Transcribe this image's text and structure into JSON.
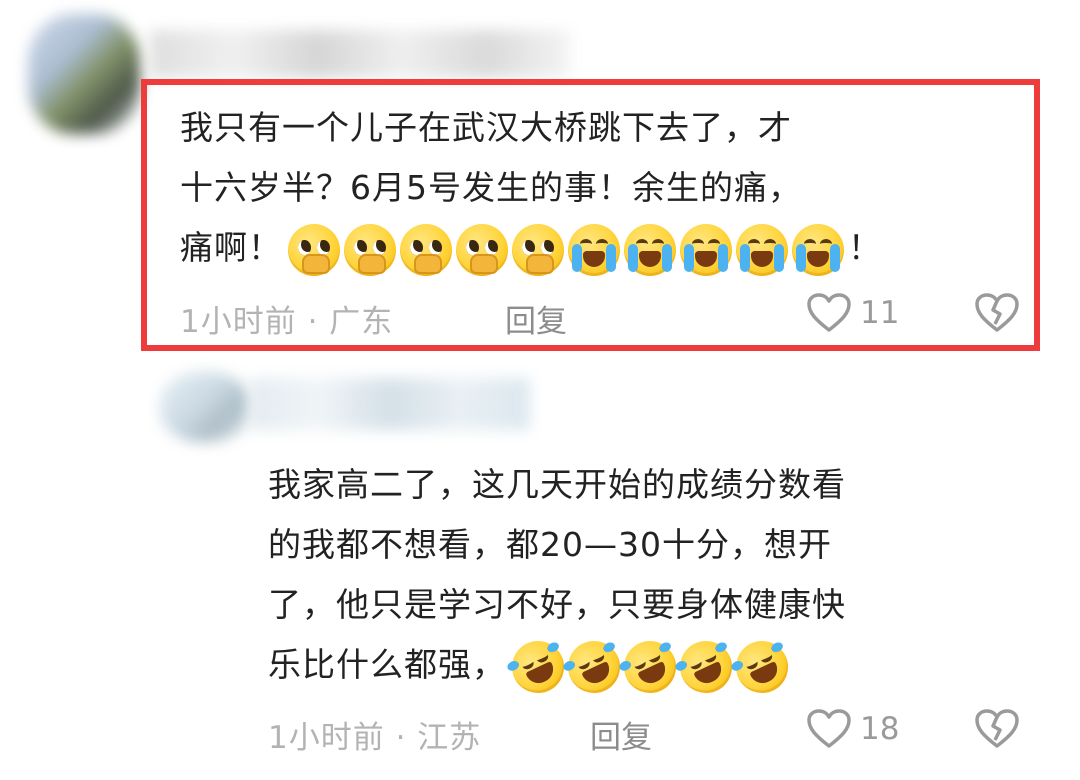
{
  "comments": [
    {
      "text_line1": "我只有一个儿子在武汉大桥跳下去了，才",
      "text_line2": "十六岁半？6月5号发生的事！余生的痛，",
      "text_line3_prefix": "痛啊！",
      "text_line3_suffix": "！",
      "emojis": [
        "pleading-face-icon",
        "pleading-face-icon",
        "pleading-face-icon",
        "pleading-face-icon",
        "pleading-face-icon",
        "loudly-crying-face-icon",
        "loudly-crying-face-icon",
        "loudly-crying-face-icon",
        "loudly-crying-face-icon",
        "loudly-crying-face-icon"
      ],
      "meta": "1小时前 · 广东",
      "reply_label": "回复",
      "like_count": "11",
      "highlighted": true,
      "highlight_color": "#ee3b3b"
    },
    {
      "text_line1": "我家高二了，这几天开始的成绩分数看",
      "text_line2": "的我都不想看，都20—30十分，想开",
      "text_line3": "了，他只是学习不好，只要身体健康快",
      "text_line4_prefix": "乐比什么都强，",
      "emojis": [
        "rolling-laughing-face-icon",
        "rolling-laughing-face-icon",
        "rolling-laughing-face-icon",
        "rolling-laughing-face-icon",
        "rolling-laughing-face-icon"
      ],
      "meta": "1小时前 · 江苏",
      "reply_label": "回复",
      "like_count": "18",
      "highlighted": false
    }
  ],
  "colors": {
    "text": "#222222",
    "meta": "#b3b3b3",
    "reply": "#8c8c8c",
    "icon": "#9a9a9a"
  }
}
